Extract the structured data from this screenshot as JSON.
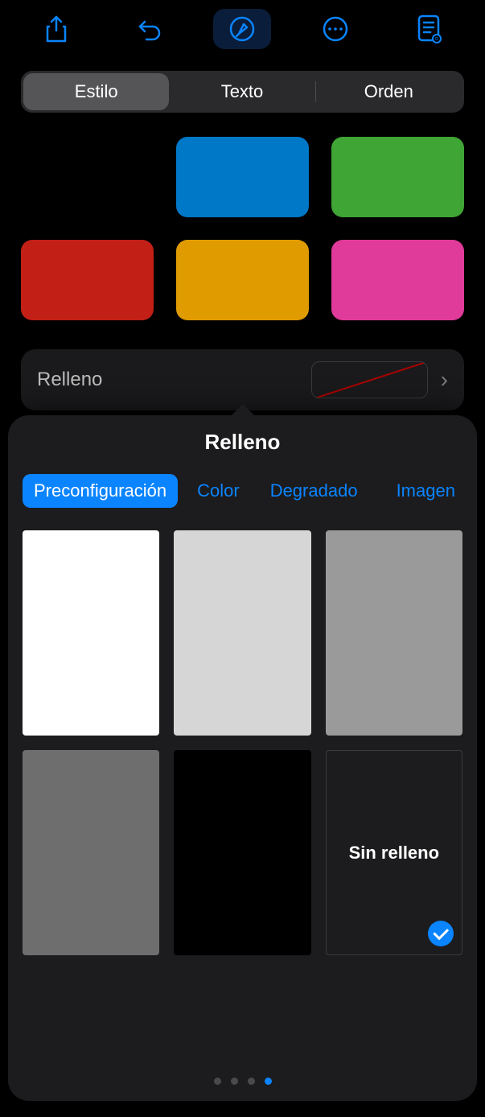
{
  "toolbar": {
    "icons": [
      "share-icon",
      "undo-icon",
      "format-brush-icon",
      "more-icon",
      "reader-icon"
    ],
    "active_index": 2
  },
  "segmented": {
    "options": [
      "Estilo",
      "Texto",
      "Orden"
    ],
    "selected_index": 0
  },
  "style_swatches": [
    "#000000",
    "#0078c8",
    "#3fa535",
    "#c22016",
    "#e09b00",
    "#e03a9a"
  ],
  "fill_row": {
    "label": "Relleno"
  },
  "popover": {
    "title": "Relleno",
    "tabs": [
      "Preconfiguración",
      "Color",
      "Degradado",
      "Imagen"
    ],
    "selected_tab_index": 0,
    "presets": [
      {
        "type": "color",
        "value": "#ffffff"
      },
      {
        "type": "color",
        "value": "#d6d6d6"
      },
      {
        "type": "color",
        "value": "#9a9a9a"
      },
      {
        "type": "color",
        "value": "#6e6e6e"
      },
      {
        "type": "color",
        "value": "#000000"
      },
      {
        "type": "none",
        "label": "Sin relleno",
        "selected": true
      }
    ],
    "page_dots": {
      "count": 4,
      "active_index": 3
    }
  }
}
